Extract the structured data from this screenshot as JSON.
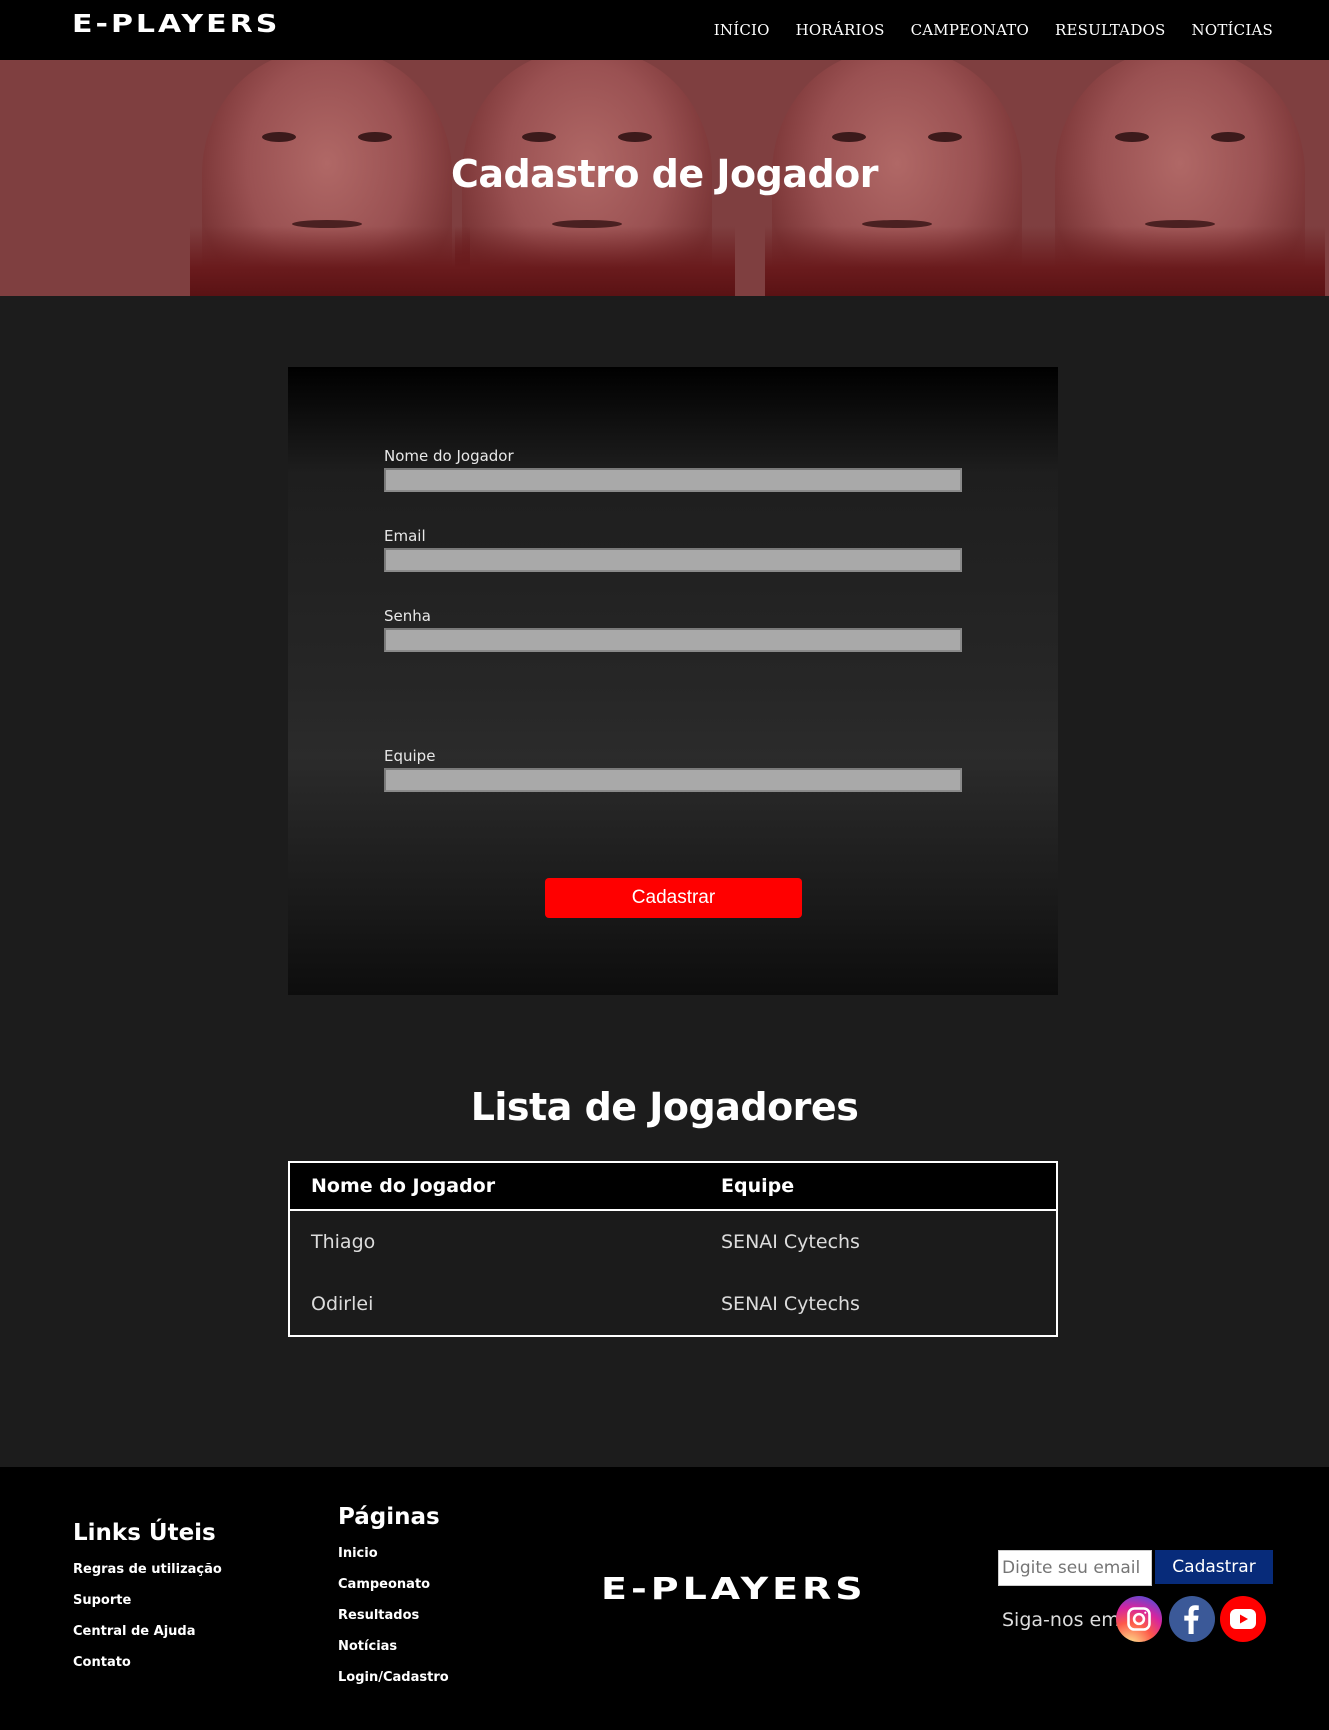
{
  "header": {
    "logo": "E-PLAYERS",
    "nav": [
      "INÍCIO",
      "HORÁRIOS",
      "CAMPEONATO",
      "RESULTADOS",
      "NOTÍCIAS"
    ]
  },
  "hero": {
    "title": "Cadastro de Jogador"
  },
  "form": {
    "fields": [
      {
        "label": "Nome do Jogador",
        "value": ""
      },
      {
        "label": "Email",
        "value": ""
      },
      {
        "label": "Senha",
        "value": ""
      },
      {
        "label": "Equipe",
        "value": ""
      }
    ],
    "submit_label": "Cadastrar"
  },
  "players": {
    "title": "Lista de Jogadores",
    "headers": [
      "Nome do Jogador",
      "Equipe"
    ],
    "rows": [
      [
        "Thiago",
        "SENAI Cytechs"
      ],
      [
        "Odirlei",
        "SENAI Cytechs"
      ]
    ]
  },
  "footer": {
    "links_title": "Links Úteis",
    "links": [
      "Regras de utilização",
      "Suporte",
      "Central de Ajuda",
      "Contato"
    ],
    "pages_title": "Páginas",
    "pages": [
      "Inicio",
      "Campeonato",
      "Resultados",
      "Notícias",
      "Login/Cadastro"
    ],
    "logo": "E-PLAYERS",
    "newsletter": {
      "placeholder": "Digite seu email",
      "button_label": "Cadastrar"
    },
    "follow_label": "Siga-nos em:",
    "social_icons": [
      "instagram-icon",
      "facebook-icon",
      "youtube-icon"
    ]
  },
  "colors": {
    "hero_overlay": "#7f3f40",
    "accent_button": "#ff0000",
    "newsletter_button": "#072b7a"
  }
}
